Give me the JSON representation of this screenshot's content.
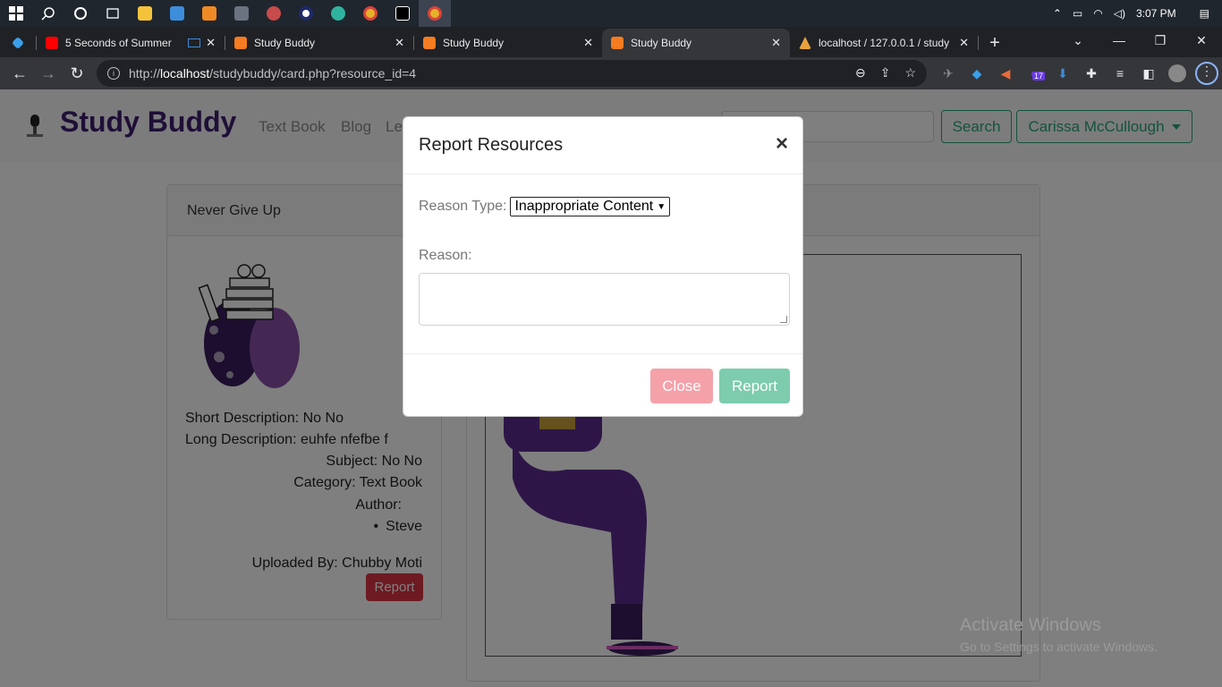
{
  "taskbar": {
    "clock": "3:07 PM"
  },
  "tabs": [
    {
      "title": "5 Seconds of Summer",
      "active": false
    },
    {
      "title": "Study Buddy",
      "active": false
    },
    {
      "title": "Study Buddy",
      "active": false
    },
    {
      "title": "Study Buddy",
      "active": true
    },
    {
      "title": "localhost / 127.0.0.1 / study",
      "active": false
    }
  ],
  "address": {
    "prefix": "http://",
    "host": "localhost",
    "path": "/studybuddy/card.php?resource_id=4"
  },
  "extension_badge": "17",
  "site": {
    "brand": "Study Buddy",
    "nav": [
      "Text Book",
      "Blog",
      "Le"
    ],
    "search_label": "Search",
    "user_label": "Carissa McCullough"
  },
  "resource": {
    "title": "Never Give Up",
    "short_desc": "Short Description: No No",
    "long_desc": "Long Description: euhfe nfefbe f",
    "subject": "Subject: No No",
    "category": "Category: Text Book",
    "author_label": "Author:",
    "author": "Steve",
    "uploaded_by": "Uploaded By: Chubby Moti",
    "report_label": "Report"
  },
  "modal": {
    "title": "Report Resources",
    "close_glyph": "×",
    "reason_type_label": "Reason Type:",
    "reason_type_value": "Inappropriate Content",
    "reason_label": "Reason:",
    "reason_value": "",
    "close_label": "Close",
    "report_label": "Report"
  },
  "watermark": {
    "line1": "Activate Windows",
    "line2": "Go to Settings to activate Windows."
  },
  "colors": {
    "brand": "#3f1f6e",
    "success": "#28a775",
    "danger": "#dc3545"
  }
}
